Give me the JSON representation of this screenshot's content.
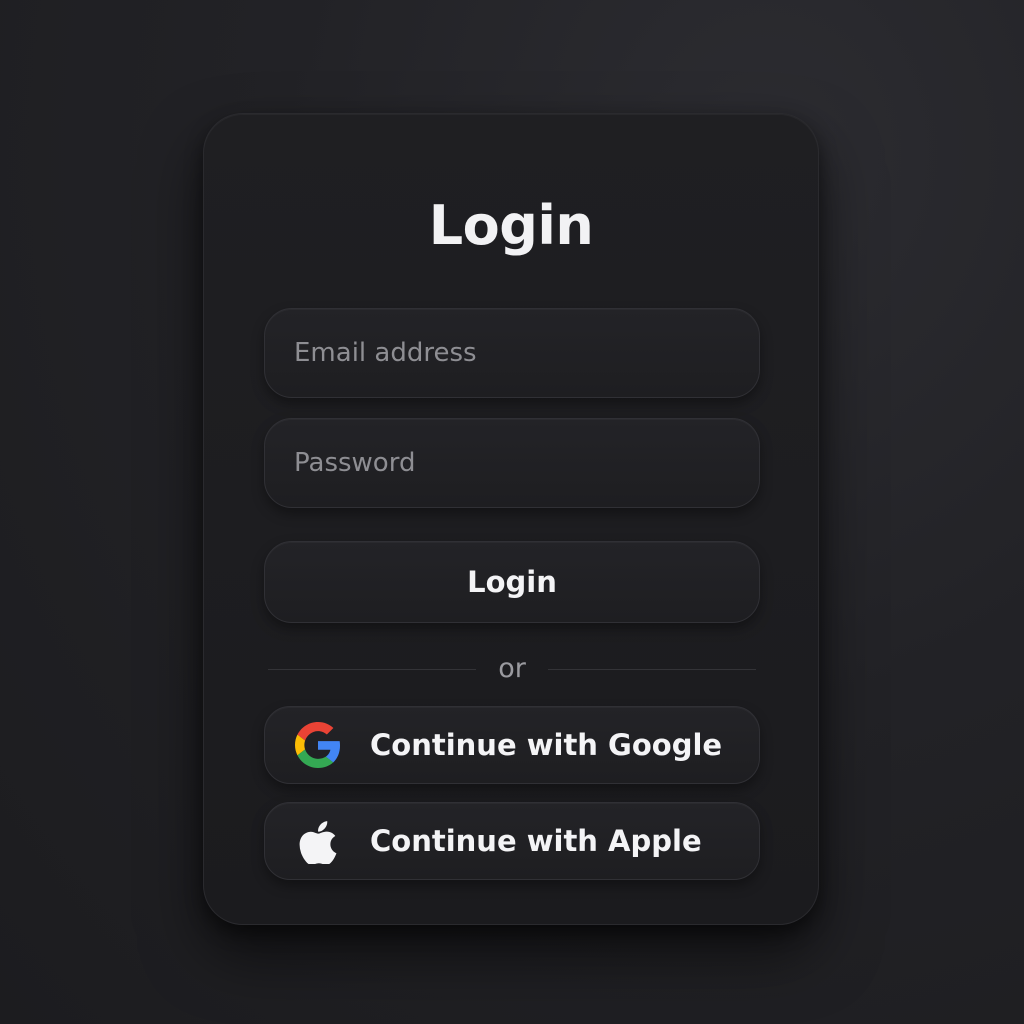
{
  "login_card": {
    "title": "Login",
    "email": {
      "placeholder": "Email address",
      "value": ""
    },
    "password": {
      "placeholder": "Password",
      "value": ""
    },
    "login_button_label": "Login",
    "divider_text": "or",
    "social_buttons": [
      {
        "label": "Continue with Google",
        "icon": "google-icon"
      },
      {
        "label": "Continue with Apple",
        "icon": "apple-icon"
      }
    ]
  },
  "colors": {
    "background": "#222226",
    "card": "#1d1d20",
    "text_primary": "#f2f2f4",
    "text_placeholder": "#8e8e93",
    "google_blue": "#4285F4",
    "google_red": "#EA4335",
    "google_yellow": "#FBBC05",
    "google_green": "#34A853"
  }
}
